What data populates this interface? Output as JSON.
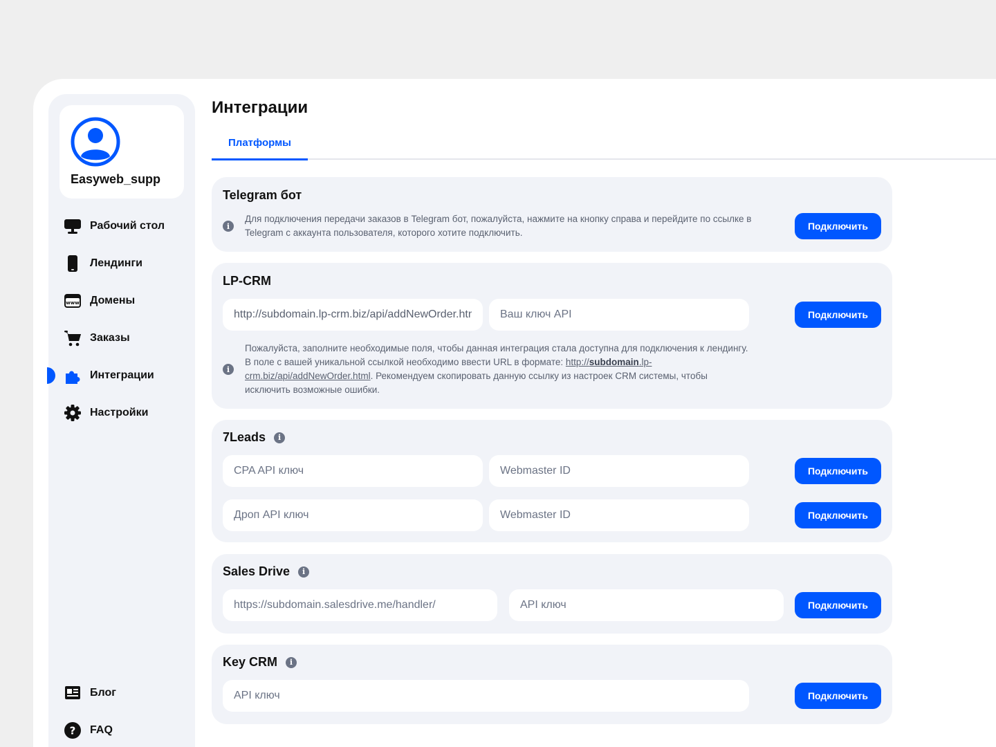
{
  "profile": {
    "username": "Easyweb_supp"
  },
  "nav": {
    "items": [
      {
        "label": "Рабочий стол",
        "icon": "monitor-icon"
      },
      {
        "label": "Лендинги",
        "icon": "smartphone-icon"
      },
      {
        "label": "Домены",
        "icon": "browser-www-icon"
      },
      {
        "label": "Заказы",
        "icon": "cart-icon"
      },
      {
        "label": "Интеграции",
        "icon": "puzzle-icon",
        "active": true
      },
      {
        "label": "Настройки",
        "icon": "gear-icon"
      }
    ],
    "bottom": [
      {
        "label": "Блог",
        "icon": "newspaper-icon"
      },
      {
        "label": "FAQ",
        "icon": "question-icon"
      }
    ]
  },
  "page": {
    "title": "Интеграции",
    "tabs": [
      {
        "label": "Платформы",
        "active": true
      }
    ]
  },
  "integrations": {
    "telegram": {
      "title": "Telegram бот",
      "help": "Для подключения передачи заказов в Telegram бот, пожалуйста, нажмите на кнопку справа и перейдите по ссылке в Telegram с аккаунта пользователя, которого хотите подключить.",
      "button": "Подключить"
    },
    "lpcrm": {
      "title": "LP-CRM",
      "url_value": "http://subdomain.lp-crm.biz/api/addNewOrder.html",
      "key_placeholder": "Ваш ключ API",
      "help_before": "Пожалуйста, заполните необходимые поля, чтобы данная интеграция стала доступна для подключения к лендингу. В поле с вашей уникальной ссылкой необходимо ввести URL в формате: ",
      "help_link_prefix": "http://",
      "help_link_bold": "subdomain",
      "help_link_rest": ".lp-crm.biz/api/addNewOrder.html",
      "help_after": ". Рекомендуем скопировать данную ссылку из настроек CRM системы, чтобы исключить возможные ошибки.",
      "button": "Подключить"
    },
    "sevenleads": {
      "title": "7Leads",
      "row1": {
        "key_placeholder": "CPA API ключ",
        "id_placeholder": "Webmaster ID",
        "button": "Подключить"
      },
      "row2": {
        "key_placeholder": "Дроп API ключ",
        "id_placeholder": "Webmaster ID",
        "button": "Подключить"
      }
    },
    "salesdrive": {
      "title": "Sales Drive",
      "url_placeholder": "https://subdomain.salesdrive.me/handler/",
      "key_placeholder": "API ключ",
      "button": "Подключить"
    },
    "keycrm": {
      "title": "Key CRM",
      "key_placeholder": "API ключ",
      "button": "Подключить"
    }
  },
  "colors": {
    "accent": "#0057ff",
    "card_bg": "#f1f3f8",
    "page_bg": "#efefef"
  }
}
